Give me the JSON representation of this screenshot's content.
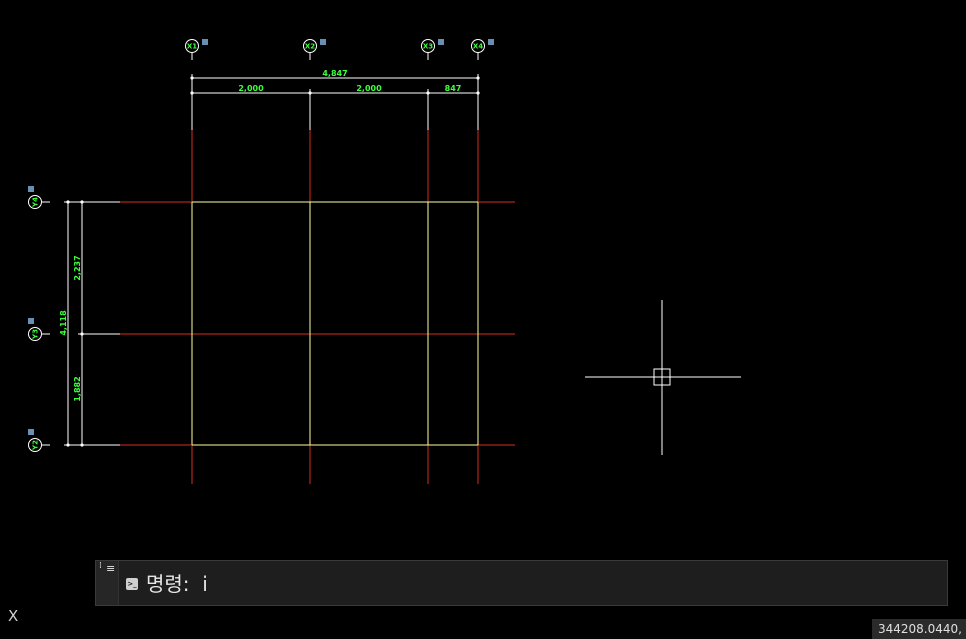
{
  "drawing": {
    "top_dimensions": {
      "overall": "4,847",
      "segments": [
        "2,000",
        "2,000",
        "847"
      ]
    },
    "left_dimensions": {
      "overall": "4,118",
      "segments": [
        "2,237",
        "1,882"
      ]
    },
    "grid_bubbles_top": [
      "X1",
      "X2",
      "X3",
      "X4"
    ],
    "grid_bubbles_left": [
      "Y4",
      "Y3",
      "Y2"
    ],
    "colors": {
      "background": "#000000",
      "grid_line": "#d62c1e",
      "wall_line": "#ffff9e",
      "dimension": "#ffffff",
      "dimension_text": "#3cff3c",
      "bubble": "#ffffff",
      "bubble_text": "#3cff3c",
      "bubble_tag": "#6a8fb5",
      "crosshair": "#ffffff"
    }
  },
  "command_line": {
    "grip_icon": "grip-dots-icon",
    "menu_icon": "menu-icon",
    "prompt_icon": "command-prompt-icon",
    "text": "명령:  i"
  },
  "ucs": {
    "x_label": "X"
  },
  "status": {
    "coordinates": "344208.0440,"
  }
}
